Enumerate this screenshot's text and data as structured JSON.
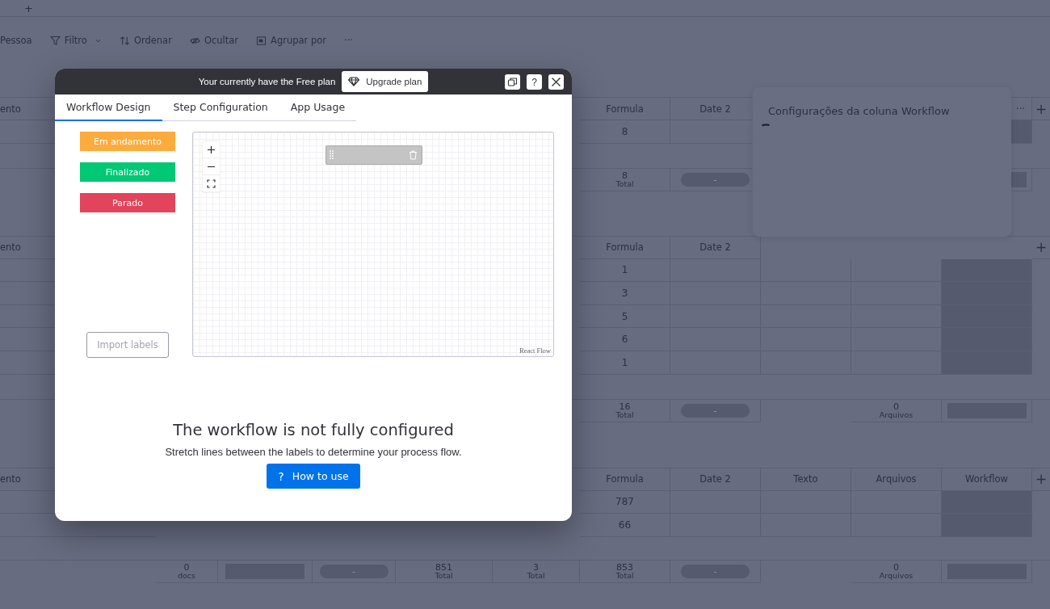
{
  "topbar": {
    "add_tab": "+"
  },
  "toolbar": [
    {
      "kind": "person",
      "label": "Pessoa"
    },
    {
      "kind": "filter",
      "label": "Filtro"
    },
    {
      "kind": "sort",
      "label": "Ordenar"
    },
    {
      "kind": "hide",
      "label": "Ocultar"
    },
    {
      "kind": "group",
      "label": "Agrupar por"
    },
    {
      "kind": "more",
      "label": "···"
    }
  ],
  "groups": [
    {
      "header": {
        "name": "ento",
        "formula": "Formula",
        "date_2": "Date 2",
        "workflow_menu": "···",
        "add": "+"
      },
      "rows": [
        {
          "formula": "8"
        }
      ],
      "summary": {
        "formula": {
          "kind": "total",
          "value": "8",
          "label": "Total"
        },
        "date_2": {
          "kind": "pill",
          "value": "-"
        },
        "workflow": {
          "kind": "bar"
        }
      }
    },
    {
      "header": {
        "name": "ento",
        "formula": "Formula",
        "date_2": "Date 2",
        "add": "+"
      },
      "rows": [
        {
          "formula": "1"
        },
        {
          "formula": "3"
        },
        {
          "formula": "5"
        },
        {
          "formula": "6"
        },
        {
          "formula": "1"
        }
      ],
      "summary": {
        "formula": {
          "kind": "total",
          "value": "16",
          "label": "Total"
        },
        "date_2": {
          "kind": "pill",
          "value": "-"
        },
        "arquivos": {
          "kind": "total",
          "value": "0",
          "label": "Arquivos"
        },
        "workflow": {
          "kind": "bar"
        }
      }
    },
    {
      "header": {
        "name": "ento",
        "formula": "Formula",
        "date_2": "Date 2",
        "texto": "Texto",
        "arquivos": "Arquivos",
        "workflow": "Workflow",
        "add": "+"
      },
      "rows": [
        {
          "formula": "787"
        },
        {
          "formula": "66"
        }
      ]
    }
  ],
  "board_summary": {
    "docs": {
      "kind": "total",
      "value": "0",
      "label": "docs"
    },
    "people": {
      "kind": "bar"
    },
    "status": {
      "kind": "pill",
      "value": "-"
    },
    "numbers": {
      "kind": "total",
      "value": "851",
      "label": "Total"
    },
    "numbers_2": {
      "kind": "total",
      "value": "3",
      "label": "Total"
    },
    "formula": {
      "kind": "total",
      "value": "853",
      "label": "Total"
    },
    "date_2": {
      "kind": "pill",
      "value": "-"
    },
    "arquivos": {
      "kind": "total",
      "value": "0",
      "label": "Arquivos"
    },
    "workflow": {
      "kind": "bar"
    }
  },
  "column_settings": {
    "title": "Configurações da coluna Workflow"
  },
  "modal": {
    "banner": {
      "text": "Your currently have the Free plan",
      "upgrade_button": "Upgrade plan"
    },
    "help_button": "?",
    "tabs": [
      {
        "label": "Workflow Design",
        "selected": true
      },
      {
        "label": "Step Configuration",
        "selected": false
      },
      {
        "label": "App Usage",
        "selected": false
      }
    ],
    "labels": [
      {
        "text": "Em andamento",
        "color": "#fdab3d"
      },
      {
        "text": "Finalizado",
        "color": "#00c875"
      },
      {
        "text": "Parado",
        "color": "#e2445c"
      }
    ],
    "import_button": {
      "label": "Import labels",
      "disabled": true
    },
    "canvas": {
      "attribution": "React Flow"
    },
    "empty_state": {
      "title": "The workflow is not fully configured",
      "description": "Stretch lines between the labels to determine your process flow.",
      "button_icon": "?",
      "button": "How to use"
    }
  }
}
